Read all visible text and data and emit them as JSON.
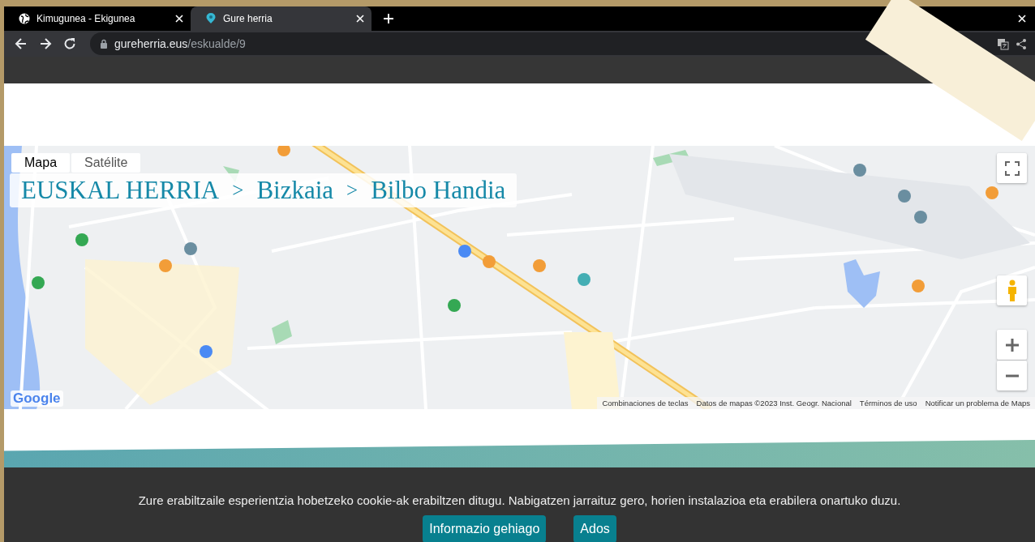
{
  "browser": {
    "tabs": [
      {
        "title": "Kimugunea - Ekigunea",
        "selected": false
      },
      {
        "title": "Gure herria",
        "selected": true
      }
    ],
    "url": {
      "host": "gureherria.eus",
      "path": "/eskualde/9"
    }
  },
  "map": {
    "type_buttons": [
      {
        "label": "Mapa",
        "selected": true
      },
      {
        "label": "Satélite",
        "selected": false
      }
    ],
    "breadcrumb": [
      {
        "kind": "crumb",
        "text": "EUSKAL HERRIA"
      },
      {
        "kind": "separator",
        "text": ">"
      },
      {
        "kind": "crumb",
        "text": "Bizkaia"
      },
      {
        "kind": "separator",
        "text": ">"
      },
      {
        "kind": "crumb",
        "text": "Bilbo Handia"
      }
    ],
    "logo": "Google",
    "attribution": [
      "Combinaciones de teclas",
      "Datos de mapas ©2023 Inst. Geogr. Nacional",
      "Términos de uso",
      "Notificar un problema de Maps"
    ]
  },
  "cookie_notice": {
    "text": "Zure erabiltzaile esperientzia hobetzeko cookie-ak erabiltzen ditugu. Nabigatzen jarraituz gero, horien instalazioa eta erabilera onartuko duzu.",
    "buttons": [
      {
        "label": "Informazio gehiago"
      },
      {
        "label": "Ados"
      }
    ]
  }
}
